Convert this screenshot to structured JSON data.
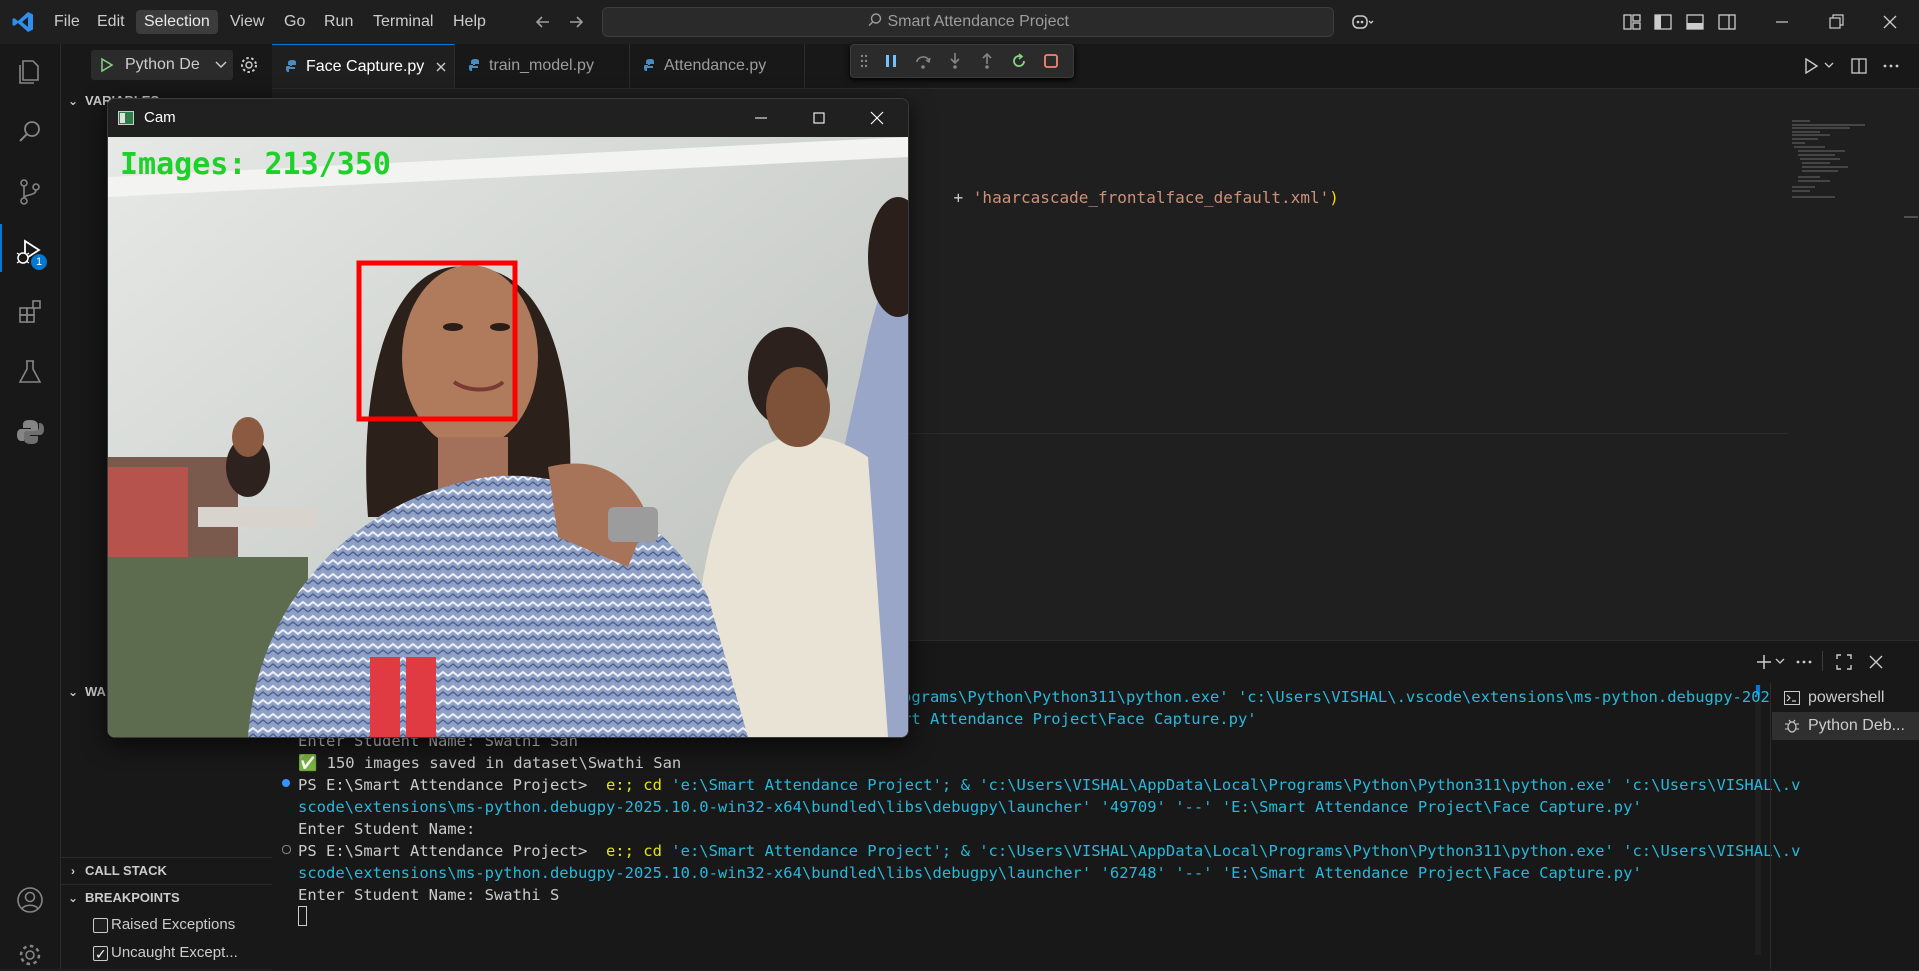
{
  "app": {
    "menu": [
      "File",
      "Edit",
      "Selection",
      "View",
      "Go",
      "Run",
      "Terminal",
      "Help"
    ],
    "active_menu": "Selection",
    "search_text": "Smart Attendance Project"
  },
  "debug": {
    "config_label": "Python De",
    "accent": "#0078d4",
    "badge": "1"
  },
  "tabs": [
    {
      "label": "Face Capture.py",
      "active": true
    },
    {
      "label": "train_model.py",
      "active": false
    },
    {
      "label": "Attendance.py",
      "active": false
    }
  ],
  "sidebar": {
    "variables_label": "VARIABLES",
    "watch_label": "WA",
    "callstack_label": "CALL STACK",
    "breakpoints_label": "BREAKPOINTS",
    "breakpoints": [
      {
        "label": "Raised Exceptions",
        "checked": false
      },
      {
        "label": "Uncaught Except...",
        "checked": true
      }
    ]
  },
  "editor": {
    "visible_code": "+ 'haarcascade_frontalface_default.xml')",
    "code_plus": "+ ",
    "code_string": "'haarcascade_frontalface_default.xml'",
    "code_paren": ")"
  },
  "terminal": {
    "lines": [
      {
        "a": "",
        "b": "",
        "c": "ograms\\Python\\Python311\\python.exe' 'c:\\Users\\VISHAL\\.vscode\\extensions\\ms-python.debugpy-202"
      },
      {
        "a": "",
        "b": "",
        "c": "rt Attendance Project\\Face Capture.py'"
      },
      {
        "a": "Enter Student Name: Swathi San",
        "b": "",
        "c": ""
      },
      {
        "a": "✅ 150 images saved in dataset\\Swathi San",
        "b": "",
        "c": ""
      },
      {
        "a": "PS E:\\Smart Attendance Project> ",
        "b": " e:; cd ",
        "c": "'e:\\Smart Attendance Project'; & 'c:\\Users\\VISHAL\\AppData\\Local\\Programs\\Python\\Python311\\python.exe' 'c:\\Users\\VISHAL\\.v"
      },
      {
        "a": "",
        "b": "",
        "c": "scode\\extensions\\ms-python.debugpy-2025.10.0-win32-x64\\bundled\\libs\\debugpy\\launcher' '49709' '--' 'E:\\Smart Attendance Project\\Face Capture.py'"
      },
      {
        "a": "Enter Student Name:",
        "b": "",
        "c": ""
      },
      {
        "a": "PS E:\\Smart Attendance Project> ",
        "b": " e:; cd ",
        "c": "'e:\\Smart Attendance Project'; & 'c:\\Users\\VISHAL\\AppData\\Local\\Programs\\Python\\Python311\\python.exe' 'c:\\Users\\VISHAL\\.v"
      },
      {
        "a": "",
        "b": "",
        "c": "scode\\extensions\\ms-python.debugpy-2025.10.0-win32-x64\\bundled\\libs\\debugpy\\launcher' '62748' '--' 'E:\\Smart Attendance Project\\Face Capture.py'"
      },
      {
        "a": "Enter Student Name: Swathi S",
        "b": "",
        "c": ""
      }
    ],
    "sessions": [
      "powershell",
      "Python Deb..."
    ]
  },
  "cam_window": {
    "title": "Cam",
    "counter": "Images: 213/350",
    "counter_color": "#1ed12a",
    "face_box_color": "#ff0000"
  }
}
